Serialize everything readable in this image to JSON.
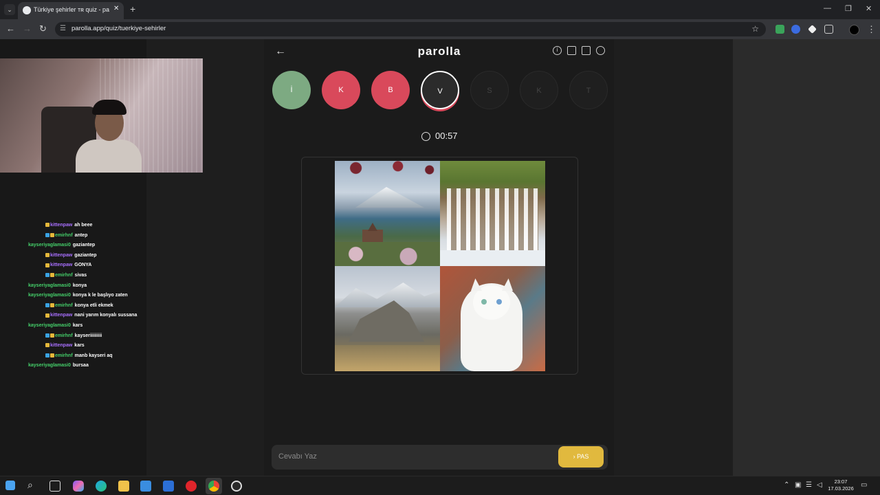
{
  "browser": {
    "tab_title": "Türkiye şehirler ᴛʀ quiz - parolla",
    "url": "parolla.app/quiz/tuerkiye-sehirler",
    "new_tab": "+",
    "close_tab": "✕"
  },
  "quiz": {
    "logo": "parolla",
    "letters": [
      {
        "letter": "İ",
        "state": "correct",
        "color": "#7daa82"
      },
      {
        "letter": "K",
        "state": "wrong",
        "color": "#d9495b"
      },
      {
        "letter": "B",
        "state": "wrong",
        "color": "#d9495b"
      },
      {
        "letter": "V",
        "state": "current",
        "color": "#2b2b2b"
      },
      {
        "letter": "S",
        "state": "pending",
        "color": "#1f1f1f"
      },
      {
        "letter": "K",
        "state": "pending",
        "color": "#1f1f1f"
      },
      {
        "letter": "T",
        "state": "pending",
        "color": "#1f1f1f"
      }
    ],
    "timer": "00:57",
    "images": [
      {
        "subject": "lake-mountain-church",
        "alt": ""
      },
      {
        "subject": "waterfall",
        "alt": ""
      },
      {
        "subject": "castle-hill",
        "alt": ""
      },
      {
        "subject": "white-van-cat",
        "alt": ""
      }
    ],
    "answer_placeholder": "Cevabı Yaz",
    "pass_label": "PAS"
  },
  "chat": [
    {
      "user": "kittenpaw",
      "msg": "ah beee",
      "color": "#a970ff",
      "badges": [
        "#e5b83b"
      ]
    },
    {
      "user": "emirhnf",
      "msg": "antep",
      "color": "#45d06a",
      "badges": [
        "#3aa3e3",
        "#e5b83b"
      ]
    },
    {
      "user": "kayseriyaglamasi0",
      "msg": "gaziantep",
      "color": "#45d06a",
      "badges": []
    },
    {
      "user": "kittenpaw",
      "msg": "gaziantep",
      "color": "#a970ff",
      "badges": [
        "#e5b83b"
      ]
    },
    {
      "user": "kittenpaw",
      "msg": "GONYA",
      "color": "#a970ff",
      "badges": [
        "#e5b83b"
      ]
    },
    {
      "user": "emirhnf",
      "msg": "sivas",
      "color": "#45d06a",
      "badges": [
        "#3aa3e3",
        "#e5b83b"
      ]
    },
    {
      "user": "kayseriyaglamasi0",
      "msg": "konya",
      "color": "#45d06a",
      "badges": []
    },
    {
      "user": "kayseriyaglamasi0",
      "msg": "konya k le başlıyo zaten",
      "color": "#45d06a",
      "badges": []
    },
    {
      "user": "emirhnf",
      "msg": "konya etli ekmek",
      "color": "#45d06a",
      "badges": [
        "#3aa3e3",
        "#e5b83b"
      ]
    },
    {
      "user": "kittenpaw",
      "msg": "nani yarım konyalı sussana",
      "color": "#a970ff",
      "badges": [
        "#e5b83b"
      ]
    },
    {
      "user": "kayseriyaglamasi0",
      "msg": "kars",
      "color": "#45d06a",
      "badges": []
    },
    {
      "user": "emirhnf",
      "msg": "kayseriiiiiiiii",
      "color": "#45d06a",
      "badges": [
        "#3aa3e3",
        "#e5b83b"
      ]
    },
    {
      "user": "kittenpaw",
      "msg": "kars",
      "color": "#a970ff",
      "badges": [
        "#e5b83b"
      ]
    },
    {
      "user": "emirhnf",
      "msg": "manb kayseri aq",
      "color": "#45d06a",
      "badges": [
        "#3aa3e3",
        "#e5b83b"
      ]
    },
    {
      "user": "kayseriyaglamasi0",
      "msg": "bursaa",
      "color": "#45d06a",
      "badges": []
    }
  ],
  "taskbar": {
    "time": "23:07",
    "date": "17.03.2026"
  }
}
